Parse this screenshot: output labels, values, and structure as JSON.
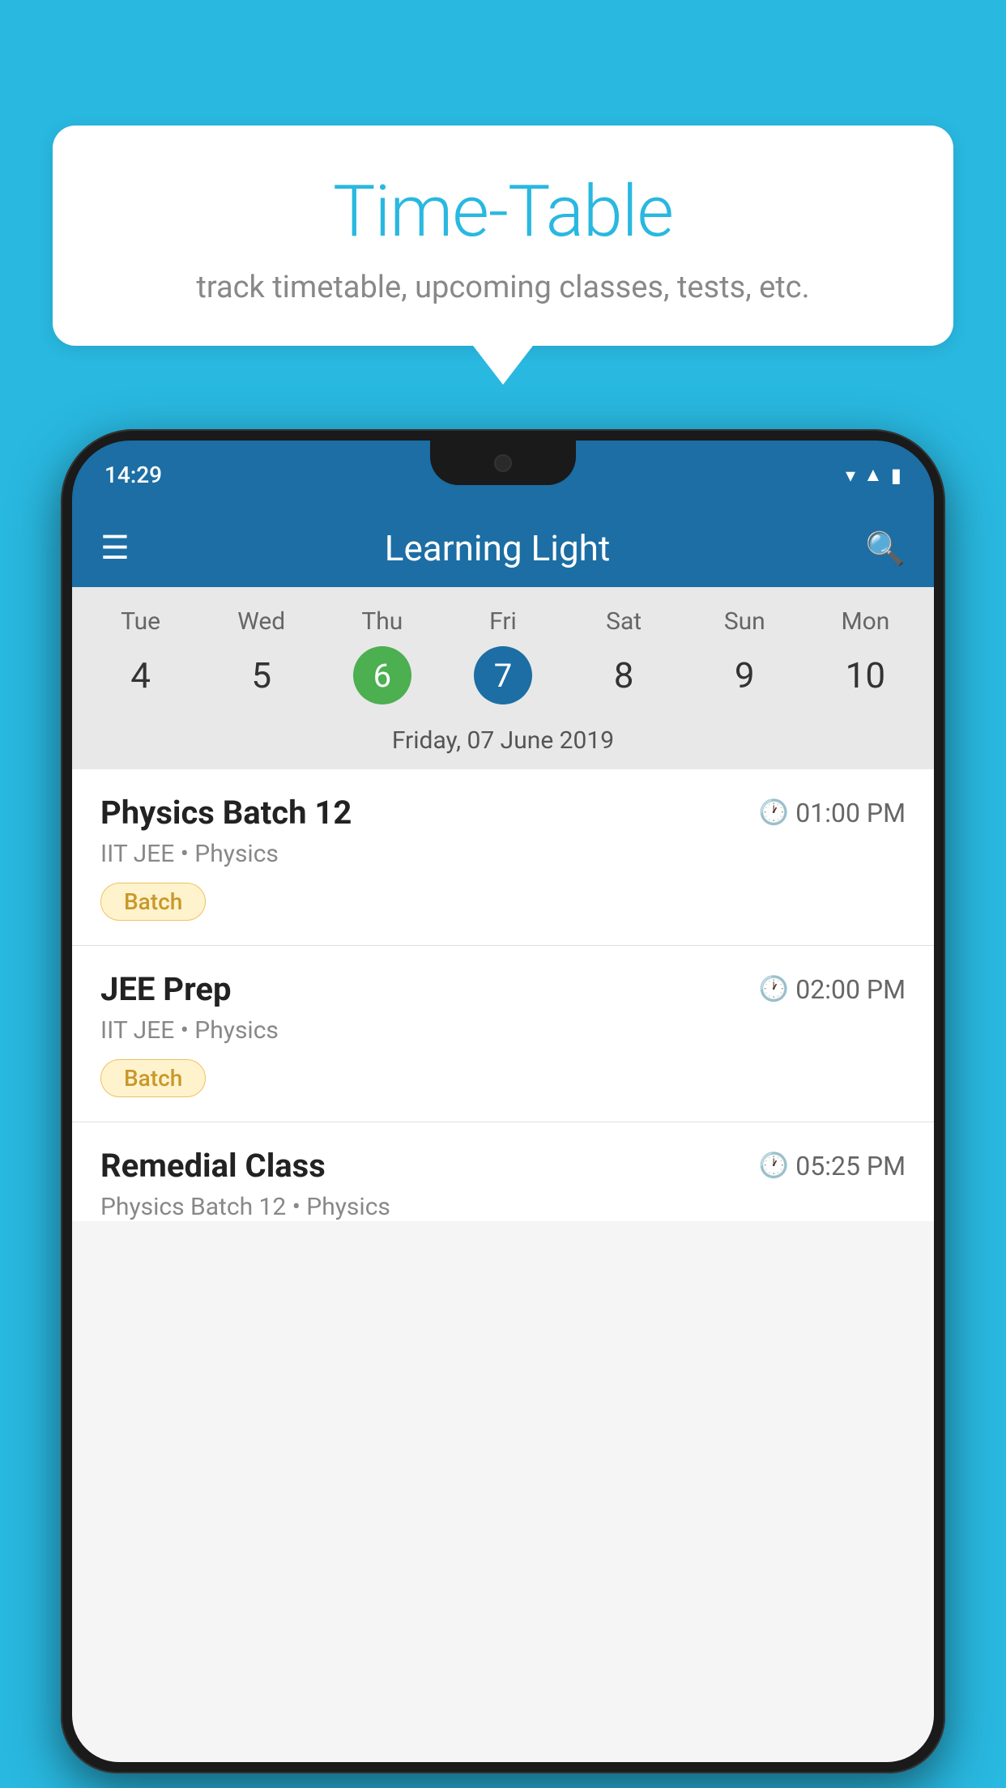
{
  "background_color": "#29B8E0",
  "speech_bubble": {
    "title": "Time-Table",
    "subtitle": "track timetable, upcoming classes, tests, etc."
  },
  "phone": {
    "status_bar": {
      "time": "14:29"
    },
    "app_header": {
      "title": "Learning Light"
    },
    "calendar": {
      "day_headers": [
        "Tue",
        "Wed",
        "Thu",
        "Fri",
        "Sat",
        "Sun",
        "Mon"
      ],
      "day_numbers": [
        "4",
        "5",
        "6",
        "7",
        "8",
        "9",
        "10"
      ],
      "today_index": 2,
      "selected_index": 3,
      "selected_date_label": "Friday, 07 June 2019"
    },
    "classes": [
      {
        "name": "Physics Batch 12",
        "time": "01:00 PM",
        "meta": "IIT JEE • Physics",
        "badge": "Batch"
      },
      {
        "name": "JEE Prep",
        "time": "02:00 PM",
        "meta": "IIT JEE • Physics",
        "badge": "Batch"
      },
      {
        "name": "Remedial Class",
        "time": "05:25 PM",
        "meta": "Physics Batch 12 • Physics",
        "badge": null
      }
    ]
  }
}
